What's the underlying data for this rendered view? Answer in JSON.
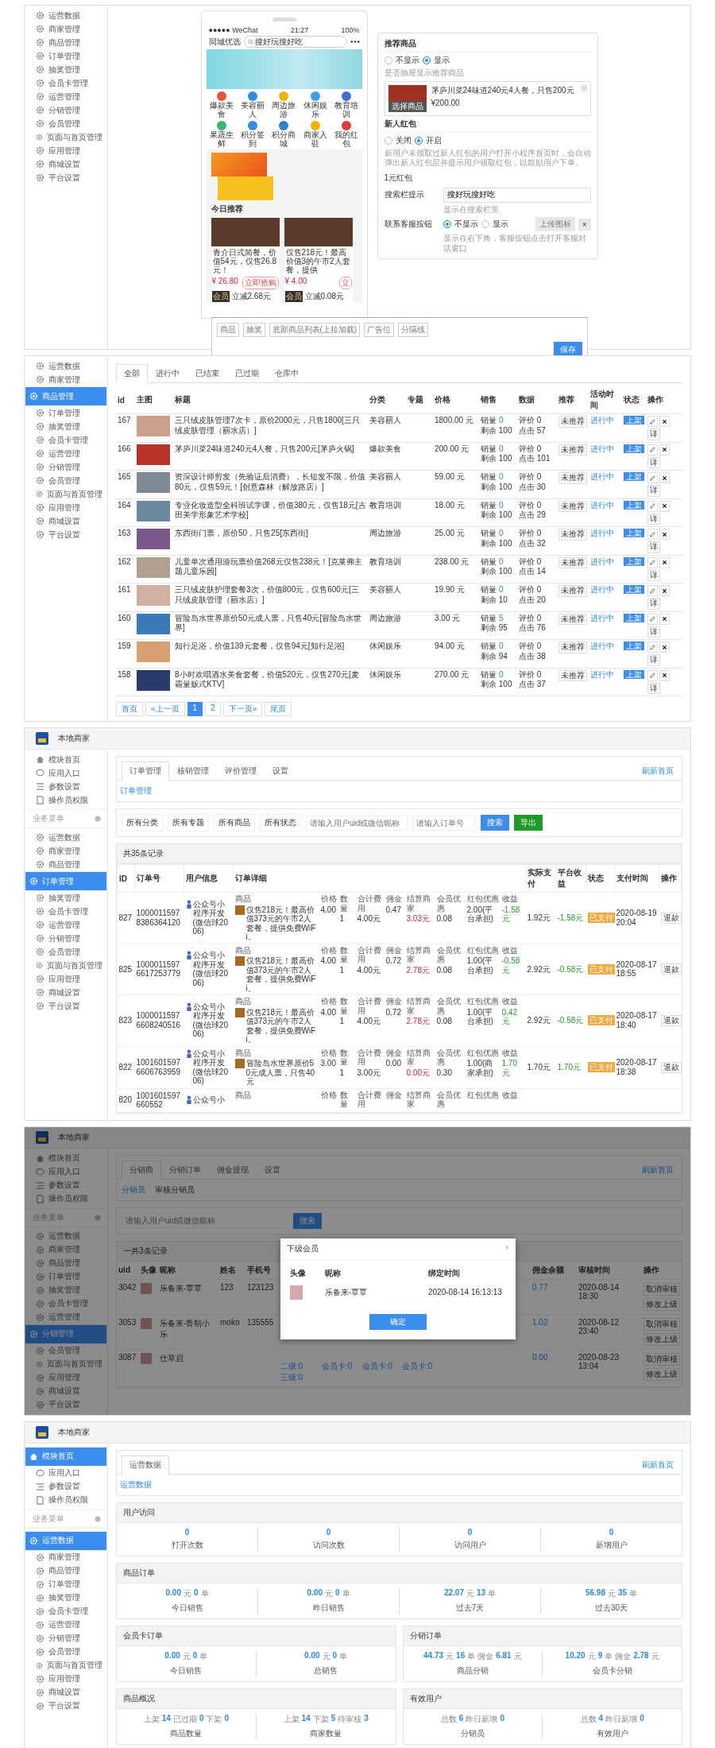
{
  "panel_editor": {
    "sidebar": [
      {
        "label": "运营数据",
        "selected": false
      },
      {
        "label": "商家管理",
        "selected": false
      },
      {
        "label": "商品管理",
        "selected": false
      },
      {
        "label": "订单管理",
        "selected": false
      },
      {
        "label": "抽奖管理",
        "selected": false
      },
      {
        "label": "会员卡管理",
        "selected": false
      },
      {
        "label": "运营管理",
        "selected": false
      },
      {
        "label": "分销管理",
        "selected": false
      },
      {
        "label": "会员管理",
        "selected": false
      },
      {
        "label": "页面与首页管理",
        "selected": false
      },
      {
        "label": "应用管理",
        "selected": false
      },
      {
        "label": "商城设置",
        "selected": false
      },
      {
        "label": "平台设置",
        "selected": false
      }
    ],
    "phone": {
      "carrier": "●●●●● WeChat",
      "time": "21:27",
      "battery": "100%",
      "title": "同城优选",
      "placeholder": "搜好玩搜好吃",
      "categories": [
        {
          "label": "爆款美食",
          "color": "#e8543a"
        },
        {
          "label": "美容丽人",
          "color": "#2f8fe0"
        },
        {
          "label": "周边旅游",
          "color": "#f0b400"
        },
        {
          "label": "休闲娱乐",
          "color": "#3aa0e8"
        },
        {
          "label": "教育培训",
          "color": "#3f6fd8"
        },
        {
          "label": "果蔬生鲜",
          "color": "#3ab56a"
        },
        {
          "label": "积分签到",
          "color": "#2f8fe0"
        },
        {
          "label": "积分商城",
          "color": "#2f7fd0"
        },
        {
          "label": "商家入驻",
          "color": "#f0b400"
        },
        {
          "label": "我的红包",
          "color": "#e03a3a"
        }
      ],
      "section_title": "今日推荐",
      "products": [
        {
          "title": "青介日式简餐，价值54元，仅售26.8元！",
          "price": "¥ 26.80",
          "buy": "立即抢购",
          "badge": "会员",
          "discount": "立减2.68元"
        },
        {
          "title": "仅售218元！最高价值3的午市2人套餐，提供",
          "price": "¥ 4.00",
          "buy": "立",
          "badge": "会员",
          "discount": "立减0.08元"
        }
      ]
    },
    "settings": {
      "recommend": {
        "title": "推荐商品",
        "options": [
          {
            "label": "不显示",
            "selected": false
          },
          {
            "label": "显示",
            "selected": true
          }
        ],
        "hint": "是否抽屉显示推荐商品",
        "product": "茅庐川菜24味道240元4人餐，只售200元",
        "price": "¥200.00",
        "choose": "选择商品"
      },
      "red_packet": {
        "title": "新人红包",
        "options": [
          {
            "label": "关闭",
            "selected": false
          },
          {
            "label": "开启",
            "selected": true
          }
        ],
        "hint": "新用户未领取过新人红包的用户打开小程序首页时，会自动弹出新人红包层并提示用户领取红包，以鼓励用户下单。",
        "amount": "1元红包"
      },
      "search": {
        "label": "搜索栏提示",
        "value": "搜好玩搜好吃",
        "hint": "显示在搜索栏里"
      },
      "service": {
        "label": "联系客服按钮",
        "options": [
          {
            "label": "不显示",
            "selected": true
          },
          {
            "label": "显示",
            "selected": false
          }
        ],
        "upload": "上传图标",
        "remove": "×",
        "hint": "显示在右下角，客服按钮点击打开客服对话窗口"
      }
    },
    "toolbar": {
      "items": [
        "商品",
        "抽奖",
        "底部商品列表(上拉加载)",
        "广告位",
        "分隔线"
      ],
      "save": "保存"
    }
  },
  "panel_products": {
    "sidebar": [
      {
        "label": "运营数据",
        "selected": false
      },
      {
        "label": "商家管理",
        "selected": false
      },
      {
        "label": "商品管理",
        "selected": true
      },
      {
        "label": "订单管理",
        "selected": false
      },
      {
        "label": "抽奖管理",
        "selected": false
      },
      {
        "label": "会员卡管理",
        "selected": false
      },
      {
        "label": "运营管理",
        "selected": false
      },
      {
        "label": "分销管理",
        "selected": false
      },
      {
        "label": "会员管理",
        "selected": false
      },
      {
        "label": "页面与首页管理",
        "selected": false
      },
      {
        "label": "应用管理",
        "selected": false
      },
      {
        "label": "商城设置",
        "selected": false
      },
      {
        "label": "平台设置",
        "selected": false
      }
    ],
    "tabs": [
      {
        "label": "全部",
        "selected": true
      },
      {
        "label": "进行中",
        "selected": false
      },
      {
        "label": "已结束",
        "selected": false
      },
      {
        "label": "已过期",
        "selected": false
      },
      {
        "label": "仓库中",
        "selected": false
      }
    ],
    "columns": [
      "id",
      "主图",
      "标题",
      "分类",
      "专题",
      "价格",
      "销售",
      "数据",
      "推荐",
      "活动时间",
      "状态",
      "操作"
    ],
    "rows": [
      {
        "id": "167",
        "title": "三只绒皮肤管理7次卡，原价2000元，只售1800[三只绒皮肤管理（丽水店）]",
        "category": "美容丽人",
        "price": "1800.00 元",
        "sold_label": "销量",
        "sold": "0",
        "stock": "剩余 100",
        "reviews": "评价 0",
        "clicks": "点击 57",
        "recommend": "未推荐",
        "activity": "进行中",
        "status": "上架",
        "detail": "详"
      },
      {
        "id": "166",
        "title": "茅庐川菜24味道240元4人餐，只售200元[茅庐火锅]",
        "category": "爆款美食",
        "price": "200.00 元",
        "sold_label": "销量",
        "sold": "0",
        "stock": "剩余 100",
        "reviews": "评价 0",
        "clicks": "点击 101",
        "recommend": "未推荐",
        "activity": "进行中",
        "status": "上架",
        "detail": "详"
      },
      {
        "id": "165",
        "title": "资深设计师剪发（先验证后消费），长短发不限，价值80元，仅售59元！[创意森林（解放路店）]",
        "category": "美容丽人",
        "price": "59.00 元",
        "sold_label": "销量",
        "sold": "0",
        "stock": "剩余 100",
        "reviews": "评价 0",
        "clicks": "点击 30",
        "recommend": "未推荐",
        "activity": "进行中",
        "status": "上架",
        "detail": "详"
      },
      {
        "id": "164",
        "title": "专业化妆造型全科班试学课，价值380元，仅售18元[吉田美学形象艺术学校]",
        "category": "教育培训",
        "price": "18.00 元",
        "sold_label": "销量",
        "sold": "0",
        "stock": "剩余 100",
        "reviews": "评价 0",
        "clicks": "点击 29",
        "recommend": "未推荐",
        "activity": "进行中",
        "status": "上架",
        "detail": "详"
      },
      {
        "id": "163",
        "title": "东西街门票，原价50，只售25[东西街]",
        "category": "周边旅游",
        "price": "25.00 元",
        "sold_label": "销量",
        "sold": "0",
        "stock": "剩余 100",
        "reviews": "评价 0",
        "clicks": "点击 32",
        "recommend": "未推荐",
        "activity": "进行中",
        "status": "上架",
        "detail": "详"
      },
      {
        "id": "162",
        "title": "儿童单次通用游玩票价值268元仅售238元！[克莱弗主题儿童乐园]",
        "category": "教育培训",
        "price": "238.00 元",
        "sold_label": "销量",
        "sold": "0",
        "stock": "剩余 100",
        "reviews": "评价 0",
        "clicks": "点击 14",
        "recommend": "未推荐",
        "activity": "进行中",
        "status": "上架",
        "detail": "详"
      },
      {
        "id": "161",
        "title": "三只绒皮肤护理套餐3次，价值800元，仅售600元[三只绒皮肤管理（丽水店）]",
        "category": "美容丽人",
        "price": "19.90 元",
        "sold_label": "销量",
        "sold": "0",
        "stock": "剩余 10",
        "reviews": "评价 0",
        "clicks": "点击 20",
        "recommend": "未推荐",
        "activity": "进行中",
        "status": "上架",
        "detail": "详"
      },
      {
        "id": "160",
        "title": "冒险岛水世界原价50元成人票，只售40元[冒险岛水世界]",
        "category": "周边旅游",
        "price": "3.00 元",
        "sold_label": "销量",
        "sold": "5",
        "stock": "剩余 95",
        "reviews": "评价 0",
        "clicks": "点击 76",
        "recommend": "未推荐",
        "activity": "进行中",
        "status": "上架",
        "detail": "详"
      },
      {
        "id": "159",
        "title": "知行足浴，价值139元套餐，仅售94元[知行足浴]",
        "category": "休闲娱乐",
        "price": "94.00 元",
        "sold_label": "销量",
        "sold": "0",
        "stock": "剩余 94",
        "reviews": "评价 0",
        "clicks": "点击 38",
        "recommend": "未推荐",
        "activity": "进行中",
        "status": "上架",
        "detail": "详"
      },
      {
        "id": "158",
        "title": "8小时欢唱酒水美食套餐，价值520元，仅售270元[麦霸量贩式KTV]",
        "category": "休闲娱乐",
        "price": "270.00 元",
        "sold_label": "销量",
        "sold": "0",
        "stock": "剩余 100",
        "reviews": "评价 0",
        "clicks": "点击 37",
        "recommend": "未推荐",
        "activity": "进行中",
        "status": "上架",
        "detail": "详"
      }
    ],
    "pagination": [
      {
        "label": "首页",
        "selected": false
      },
      {
        "label": "«上一页",
        "selected": false
      },
      {
        "label": "1",
        "selected": true
      },
      {
        "label": "2",
        "selected": false
      },
      {
        "label": "下一页»",
        "selected": false
      },
      {
        "label": "尾页",
        "selected": false
      }
    ]
  },
  "panel_orders": {
    "header": "本地商家",
    "top_menu": [
      {
        "label": "模块首页",
        "selected": false
      },
      {
        "label": "应用入口",
        "selected": false
      },
      {
        "label": "参数设置",
        "selected": false
      },
      {
        "label": "操作员权限",
        "selected": false
      }
    ],
    "section": "业务菜单",
    "sidebar": [
      {
        "label": "运营数据",
        "selected": false
      },
      {
        "label": "商家管理",
        "selected": false
      },
      {
        "label": "商品管理",
        "selected": false
      },
      {
        "label": "订单管理",
        "selected": true
      },
      {
        "label": "抽奖管理",
        "selected": false
      },
      {
        "label": "会员卡管理",
        "selected": false
      },
      {
        "label": "运营管理",
        "selected": false
      },
      {
        "label": "分销管理",
        "selected": false
      },
      {
        "label": "会员管理",
        "selected": false
      },
      {
        "label": "页面与首页管理",
        "selected": false
      },
      {
        "label": "应用管理",
        "selected": false
      },
      {
        "label": "商城设置",
        "selected": false
      },
      {
        "label": "平台设置",
        "selected": false
      }
    ],
    "tabs": [
      {
        "label": "订单管理",
        "selected": true
      },
      {
        "label": "核销管理",
        "selected": false
      },
      {
        "label": "评价管理",
        "selected": false
      },
      {
        "label": "设置",
        "selected": false
      }
    ],
    "refresh": "刷新首页",
    "sub_link": "订单管理",
    "filters": [
      "所有分类",
      "所有专题",
      "所有商品",
      "所有状态"
    ],
    "user_search": {
      "placeholder": "请输入用户uid或微信昵称"
    },
    "order_search": {
      "placeholder": "请输入订单号"
    },
    "search": "搜索",
    "export": "导出",
    "count": "共35条记录",
    "columns": [
      "ID",
      "订单号",
      "用户信息",
      "订单详细",
      "实际支付",
      "平台收益",
      "状态",
      "支付时间",
      "操作"
    ],
    "rows": [
      {
        "kind": "full",
        "id": "827",
        "order_no": "10000115978386364120",
        "user": "公众号小程序开发(微信球2006)",
        "labels": [
          "商品",
          "价格",
          "数量",
          "合计费用",
          "佣金",
          "结算商家",
          "会员优惠",
          "红包优惠",
          "收益"
        ],
        "product": "仅售218元！最高价值373元的午市2人套餐，提供免费WiFi。",
        "price": "4.00",
        "qty": "1",
        "total": "4.00元",
        "commission": "0.47",
        "settle": "3.03元",
        "member": "0.08",
        "red_packet": "2.00(平台承担)",
        "income": "-1.58元",
        "paid": "1.92元",
        "platform": "-1.58元",
        "status": "已支付",
        "time": "2020-08-19 20:04",
        "action": "退款"
      },
      {
        "kind": "full",
        "id": "825",
        "order_no": "10000115976617253779",
        "user": "公众号小程序开发(微信球2006)",
        "labels": [
          "商品",
          "价格",
          "数量",
          "合计费用",
          "佣金",
          "结算商家",
          "会员优惠",
          "红包优惠",
          "收益"
        ],
        "product": "仅售218元！最高价值373元的午市2人套餐，提供免费WiFi。",
        "price": "4.00",
        "qty": "1",
        "total": "4.00元",
        "commission": "0.72",
        "settle": "2.78元",
        "member": "0.08",
        "red_packet": "1.00(平台承担)",
        "income": "-0.58元",
        "paid": "2.92元",
        "platform": "-0.58元",
        "status": "已支付",
        "time": "2020-08-17 18:55",
        "action": "退款"
      },
      {
        "kind": "full",
        "id": "823",
        "order_no": "10000115976608240516",
        "user": "公众号小程序开发(微信球2006)",
        "labels": [
          "商品",
          "价格",
          "数量",
          "合计费用",
          "佣金",
          "结算商家",
          "会员优惠",
          "红包优惠",
          "收益"
        ],
        "product": "仅售218元！最高价值373元的午市2人套餐，提供免费WiFi。",
        "price": "4.00",
        "qty": "1",
        "total": "4.00元",
        "commission": "0.72",
        "settle": "2.78元",
        "member": "0.08",
        "red_packet": "1.00(平台承担)",
        "income": "0.42元",
        "paid": "2.92元",
        "platform": "-0.58元",
        "status": "已支付",
        "time": "2020-08-17 18:40",
        "action": "退款"
      },
      {
        "kind": "full",
        "id": "822",
        "order_no": "10016015976606763959",
        "user": "公众号小程序开发(微信球2006)",
        "labels": [
          "商品",
          "价格",
          "数量",
          "合计费用",
          "佣金",
          "结算商家",
          "会员优惠",
          "红包优惠",
          "收益"
        ],
        "product": "冒险岛水世界原价50元成人票，只售40元",
        "price": "3.00",
        "qty": "1",
        "total": "3.00元",
        "commission": "0.00",
        "settle": "0.00元",
        "member": "0.30",
        "red_packet": "1.00(商家承担)",
        "income": "1.70元",
        "paid": "1.70元",
        "platform": "1.70元",
        "status": "已支付",
        "time": "2020-08-17 18:38",
        "action": "退款"
      },
      {
        "kind": "partial",
        "id": "820",
        "order_no": "1001601597660552",
        "user": "公众号小",
        "labels": [
          "商品",
          "价格",
          "数量",
          "合计费用",
          "佣金",
          "结算商家",
          "会员优惠",
          "红包优惠",
          "收益"
        ]
      }
    ]
  },
  "panel_distribution": {
    "header": "本地商家",
    "top_menu": [
      {
        "label": "模块首页",
        "selected": false
      },
      {
        "label": "应用入口",
        "selected": false
      },
      {
        "label": "参数设置",
        "selected": false
      },
      {
        "label": "操作员权限",
        "selected": false
      }
    ],
    "section": "业务菜单",
    "sidebar": [
      {
        "label": "运营数据",
        "selected": false
      },
      {
        "label": "商家管理",
        "selected": false
      },
      {
        "label": "商品管理",
        "selected": false
      },
      {
        "label": "订单管理",
        "selected": false
      },
      {
        "label": "抽奖管理",
        "selected": false
      },
      {
        "label": "会员卡管理",
        "selected": false
      },
      {
        "label": "运营管理",
        "selected": false
      },
      {
        "label": "分销管理",
        "selected": true
      },
      {
        "label": "会员管理",
        "selected": false
      },
      {
        "label": "页面与首页管理",
        "selected": false
      },
      {
        "label": "应用管理",
        "selected": false
      },
      {
        "label": "商城设置",
        "selected": false
      },
      {
        "label": "平台设置",
        "selected": false
      }
    ],
    "tabs": [
      {
        "label": "分销商",
        "selected": true
      },
      {
        "label": "分销订单",
        "selected": false
      },
      {
        "label": "佣金提现",
        "selected": false
      },
      {
        "label": "设置",
        "selected": false
      }
    ],
    "refresh": "刷新首页",
    "sub_tabs": [
      {
        "label": "分销员",
        "selected": true
      },
      {
        "label": "审核分销员",
        "selected": false
      }
    ],
    "search_field": {
      "placeholder": "请输入用户uid或微信昵称"
    },
    "search": "搜索",
    "count": "一共3条记录",
    "columns": [
      "uid",
      "头像",
      "昵称",
      "姓名",
      "手机号",
      "佣金余额",
      "审核时间",
      "操作"
    ],
    "rows": [
      {
        "uid": "3042",
        "nickname": "乐备来-覃覃",
        "name": "123",
        "phone": "123123",
        "balance": "0.77",
        "time": "2020-08-14 18:30",
        "actions": [
          "取消审核",
          "修改上级"
        ]
      },
      {
        "uid": "3053",
        "nickname": "乐备来-鲁朝小乐",
        "name": "moko",
        "phone": "135555",
        "balance": "1.02",
        "time": "2020-08-12 23:40",
        "actions": [
          "取消审核",
          "修改上级"
        ]
      },
      {
        "uid": "3087",
        "nickname": "仕草启",
        "name": "",
        "phone": "",
        "levels": [
          "二级:0",
          "三级:0"
        ],
        "cards": [
          "会员卡:0",
          "会员卡:0",
          "会员卡:0"
        ],
        "balance": "0.00",
        "time": "2020-08-23 13:04",
        "actions": [
          "取消审核",
          "修改上级"
        ]
      }
    ],
    "modal": {
      "title": "下级会员",
      "close": "×",
      "columns": [
        "头像",
        "昵称",
        "绑定时间"
      ],
      "rows": [
        {
          "nickname": "乐备来-覃覃",
          "time": "2020-08-14 16:13:13"
        }
      ],
      "confirm": "确定"
    }
  },
  "panel_dashboard": {
    "header": "本地商家",
    "top_menu": [
      {
        "label": "模块首页",
        "selected": true
      },
      {
        "label": "应用入口",
        "selected": false
      },
      {
        "label": "参数设置",
        "selected": false
      },
      {
        "label": "操作员权限",
        "selected": false
      }
    ],
    "section": "业务菜单",
    "sidebar": [
      {
        "label": "运营数据",
        "selected": true
      },
      {
        "label": "商家管理",
        "selected": false
      },
      {
        "label": "商品管理",
        "selected": false
      },
      {
        "label": "订单管理",
        "selected": false
      },
      {
        "label": "抽奖管理",
        "selected": false
      },
      {
        "label": "会员卡管理",
        "selected": false
      },
      {
        "label": "运营管理",
        "selected": false
      },
      {
        "label": "分销管理",
        "selected": false
      },
      {
        "label": "会员管理",
        "selected": false
      },
      {
        "label": "页面与首页管理",
        "selected": false
      },
      {
        "label": "应用管理",
        "selected": false
      },
      {
        "label": "商城设置",
        "selected": false
      },
      {
        "label": "平台设置",
        "selected": false
      }
    ],
    "tabs": [
      {
        "label": "运营数据",
        "selected": true
      }
    ],
    "refresh": "刷新首页",
    "sub_link": "运营数据",
    "cards": [
      {
        "title": "用户访问",
        "stats": [
          {
            "parts": [
              {
                "v": "0"
              }
            ],
            "label": "打开次数"
          },
          {
            "parts": [
              {
                "v": "0"
              }
            ],
            "label": "访问次数"
          },
          {
            "parts": [
              {
                "v": "0"
              }
            ],
            "label": "访问用户"
          },
          {
            "parts": [
              {
                "v": "0"
              }
            ],
            "label": "新增用户"
          }
        ]
      },
      {
        "title": "商品订单",
        "stats": [
          {
            "parts": [
              {
                "v": "0.00",
                "u": "元"
              },
              {
                "v": "0",
                "u": "单"
              }
            ],
            "label": "今日销售"
          },
          {
            "parts": [
              {
                "v": "0.00",
                "u": "元"
              },
              {
                "v": "0",
                "u": "单"
              }
            ],
            "label": "昨日销售"
          },
          {
            "parts": [
              {
                "v": "22.07",
                "u": "元"
              },
              {
                "v": "13",
                "u": "单"
              }
            ],
            "label": "过去7天"
          },
          {
            "parts": [
              {
                "v": "56.98",
                "u": "元"
              },
              {
                "v": "35",
                "u": "单"
              }
            ],
            "label": "过去30天"
          }
        ]
      },
      {
        "title": "会员卡订单",
        "stats": [
          {
            "parts": [
              {
                "v": "0.00",
                "u": "元"
              },
              {
                "v": "0",
                "u": "单"
              }
            ],
            "label": "今日销售"
          },
          {
            "parts": [
              {
                "v": "0.00",
                "u": "元"
              },
              {
                "v": "0",
                "u": "单"
              }
            ],
            "label": "总销售"
          }
        ]
      },
      {
        "title": "分销订单",
        "stats": [
          {
            "parts": [
              {
                "v": "44.73",
                "u": "元"
              },
              {
                "v": "16",
                "u": "单"
              },
              {
                "l": "佣金",
                "v": "6.81",
                "u": "元"
              }
            ],
            "label": "商品分销"
          },
          {
            "parts": [
              {
                "v": "10.20",
                "u": "元"
              },
              {
                "v": "9",
                "u": "单"
              },
              {
                "l": "佣金",
                "v": "2.78",
                "u": "元"
              }
            ],
            "label": "会员卡分销"
          }
        ]
      },
      {
        "title": "商品概况",
        "stats": [
          {
            "parts": [
              {
                "l": "上架",
                "v": "14"
              },
              {
                "l": "已过期",
                "v": "0"
              },
              {
                "l": "下架",
                "v": "0"
              }
            ],
            "label": "商品数量"
          },
          {
            "parts": [
              {
                "l": "上架",
                "v": "14"
              },
              {
                "l": "下架",
                "v": "5"
              },
              {
                "l": "待审核",
                "v": "3"
              }
            ],
            "label": "商家数量"
          }
        ]
      },
      {
        "title": "有效用户",
        "stats": [
          {
            "parts": [
              {
                "l": "总数",
                "v": "6"
              },
              {
                "l": "昨日新增",
                "v": "0"
              }
            ],
            "label": "分销员"
          },
          {
            "parts": [
              {
                "l": "总数",
                "v": "4"
              },
              {
                "l": "昨日新增",
                "v": "0"
              }
            ],
            "label": "有效用户"
          }
        ]
      }
    ]
  }
}
